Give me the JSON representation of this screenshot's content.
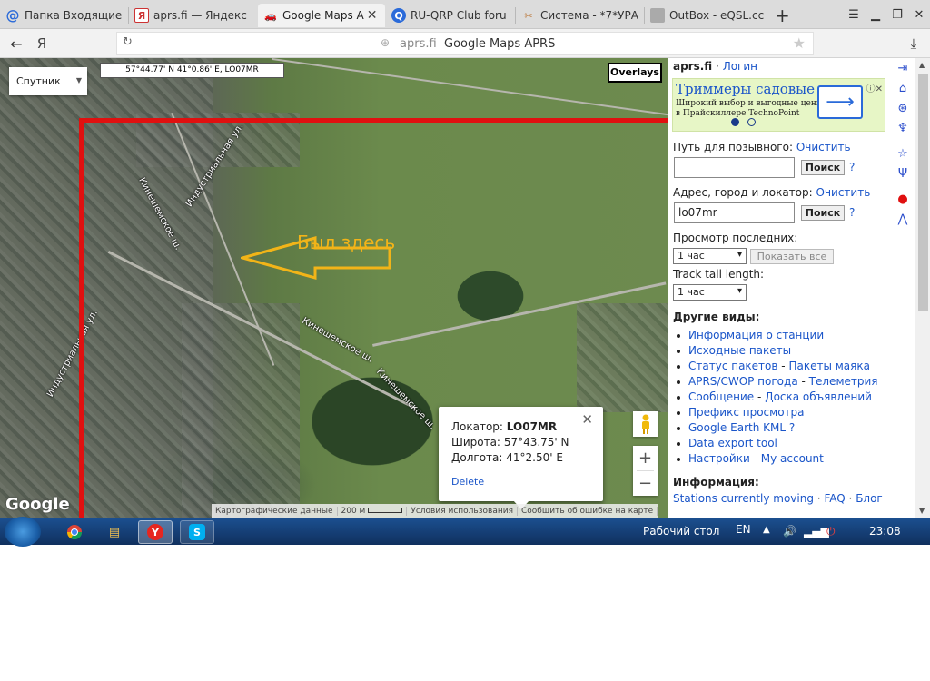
{
  "tabs": [
    {
      "title": "Папка Входящие",
      "icon": "mail-icon"
    },
    {
      "title": "aprs.fi — Яндекс",
      "icon": "yandex-icon"
    },
    {
      "title": "Google Maps A",
      "icon": "car-icon",
      "active": true
    },
    {
      "title": "RU-QRP Club foru",
      "icon": "forum-icon"
    },
    {
      "title": "Система - *7*УРА",
      "icon": "system-icon"
    },
    {
      "title": "OutBox - eQSL.cc",
      "icon": "eqsl-icon"
    }
  ],
  "new_tab_label": "+",
  "address": {
    "back": "←",
    "yandex_logo": "Я",
    "domain": "aprs.fi",
    "page_title": "Google Maps APRS"
  },
  "map": {
    "map_type_label": "Спутник",
    "cursor_coords": "57°44.77' N 41°0.86' E, LO07MR",
    "overlays_label": "Overlays",
    "annotation_text": "Был здесь",
    "street_labels": [
      "Индустриальная ул.",
      "Кинешемское ш.",
      "Кинешемское ш.",
      "Кинешемское ш.",
      "Индустриальная ул."
    ],
    "popup": {
      "locator_label": "Локатор:",
      "locator_value": "LO07MR",
      "lat_label": "Широта:",
      "lat_value": "57°43.75' N",
      "lon_label": "Долгота:",
      "lon_value": "41°2.50' E",
      "delete_label": "Delete"
    },
    "zoom_in": "+",
    "zoom_out": "−",
    "google_logo": "Google",
    "footer": {
      "map_data": "Картографические данные",
      "scale": "200 м",
      "terms": "Условия использования",
      "report": "Сообщить об ошибке на карте"
    }
  },
  "sidebar": {
    "site": "aprs.fi",
    "sep": "·",
    "login": "Логин",
    "ad": {
      "headline": "Триммеры садовые",
      "line1": "Широкий выбор и выгодные цены!",
      "line2": "в Прайскиллере TechnoPoint",
      "slide_active": 1,
      "slide_count": 2
    },
    "callsign_label": "Путь для позывного:",
    "callsign_clear": "Очистить",
    "callsign_value": "",
    "search_label": "Поиск",
    "help": "?",
    "address_label": "Адрес, город и локатор:",
    "address_clear": "Очистить",
    "address_value": "lo07mr",
    "view_last_label": "Просмотр последних:",
    "view_last_value": "1 час",
    "show_all": "Показать все",
    "track_label": "Track tail length:",
    "track_value": "1 час",
    "other_views_title": "Другие виды:",
    "views": [
      [
        "Информация о станции"
      ],
      [
        "Исходные пакеты"
      ],
      [
        "Статус пакетов",
        "Пакеты маяка"
      ],
      [
        "APRS/CWOP погода",
        "Телеметрия"
      ],
      [
        "Сообщение",
        "Доска объявлений"
      ],
      [
        "Префикс просмотра"
      ],
      [
        "Google Earth KML ?"
      ],
      [
        "Data export tool"
      ],
      [
        "Настройки",
        "My account"
      ]
    ],
    "dash": "-",
    "info_title": "Информация:",
    "info_links": [
      "Stations currently moving",
      "FAQ",
      "Блог"
    ]
  },
  "taskbar": {
    "desktop_label": "Рабочий стол",
    "lang": "EN",
    "time": "23:08"
  }
}
